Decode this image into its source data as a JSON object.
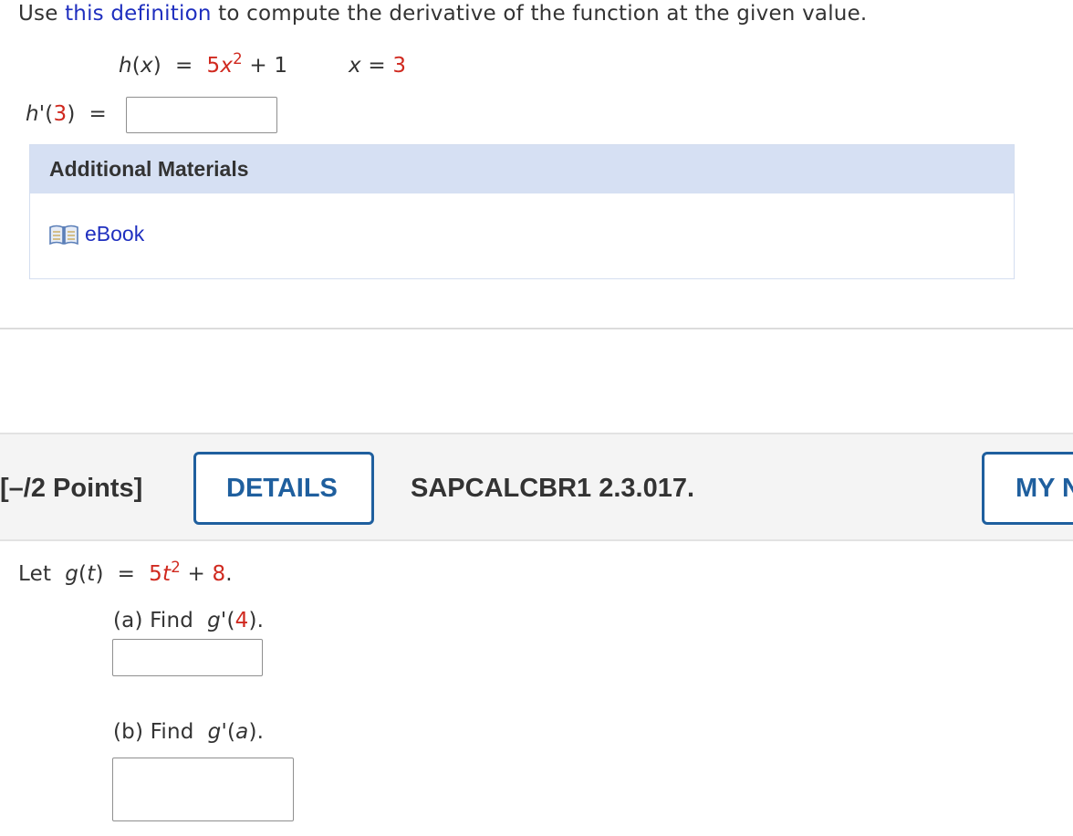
{
  "question1": {
    "intro_prefix": "Use ",
    "intro_link": "this definition",
    "intro_suffix": " to compute the derivative of the function at the given value.",
    "func_name": "h",
    "func_var": "x",
    "func_coef": "5",
    "func_exp": "2",
    "func_const": "1",
    "x_label": "x",
    "x_value": "3",
    "answer_prompt_fn": "h",
    "answer_prompt_arg": "3",
    "answer_value": ""
  },
  "additional_materials": {
    "header": "Additional Materials",
    "ebook_label": "eBook"
  },
  "question_bar": {
    "points": "[–/2 Points]",
    "details_label": "DETAILS",
    "code": "SAPCALCBR1 2.3.017.",
    "my_notes_label": "MY N"
  },
  "question2": {
    "let": "Let",
    "func_name": "g",
    "func_var": "t",
    "func_coef": "5",
    "func_exp": "2",
    "func_const": "8",
    "part_a_label": "(a) Find",
    "part_a_fn": "g",
    "part_a_arg": "4",
    "part_a_value": "",
    "part_b_label": "(b) Find",
    "part_b_fn": "g",
    "part_b_arg": "a",
    "part_b_value": ""
  },
  "colors": {
    "text": "#333333",
    "red_values": "#d0291f",
    "link": "#1f2fbf",
    "button_blue": "#1f5f9e",
    "materials_header_bg": "#d6e0f3",
    "bar_bg": "#f4f4f4"
  },
  "icons": {
    "ebook": "open-book-icon"
  }
}
